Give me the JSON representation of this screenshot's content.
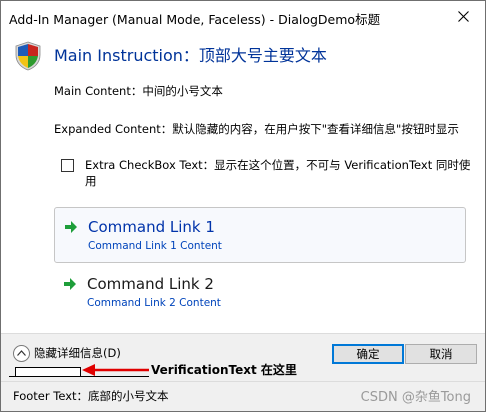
{
  "window": {
    "title": "Add-In Manager (Manual Mode, Faceless) - DialogDemo标题",
    "close_symbol": "✕"
  },
  "main_instruction": "Main Instruction：顶部大号主要文本",
  "main_content": "Main Content：中间的小号文本",
  "expanded_content": "Expanded Content：默认隐藏的内容，在用户按下\"查看详细信息\"按钮时显示",
  "checkbox": {
    "label": "Extra CheckBox Text：显示在这个位置，不可与 VerificationText 同时使用",
    "checked": false
  },
  "command_links": [
    {
      "title": "Command Link 1",
      "subtitle": "Command Link 1 Content",
      "icon": "green-arrow-icon"
    },
    {
      "title": "Command Link 2",
      "subtitle": "Command Link 2 Content",
      "icon": "green-arrow-icon"
    }
  ],
  "expando": {
    "label": "隐藏详细信息(D)",
    "icon": "chevron-up-icon"
  },
  "buttons": {
    "ok": "确定",
    "cancel": "取消"
  },
  "annotation": {
    "text": "VerificationText 在这里",
    "color": "#e00000"
  },
  "footer_text": "Footer Text：底部的小号文本",
  "watermark": "CSDN @杂鱼Tong",
  "colors": {
    "instruction": "#003399",
    "command_title": "#0033aa",
    "arrow_green": "#1e9e3a",
    "shield_blue": "#1e5bb8",
    "shield_red": "#c8251e",
    "shield_yellow": "#f2c316",
    "shield_green": "#2f9b2f"
  }
}
